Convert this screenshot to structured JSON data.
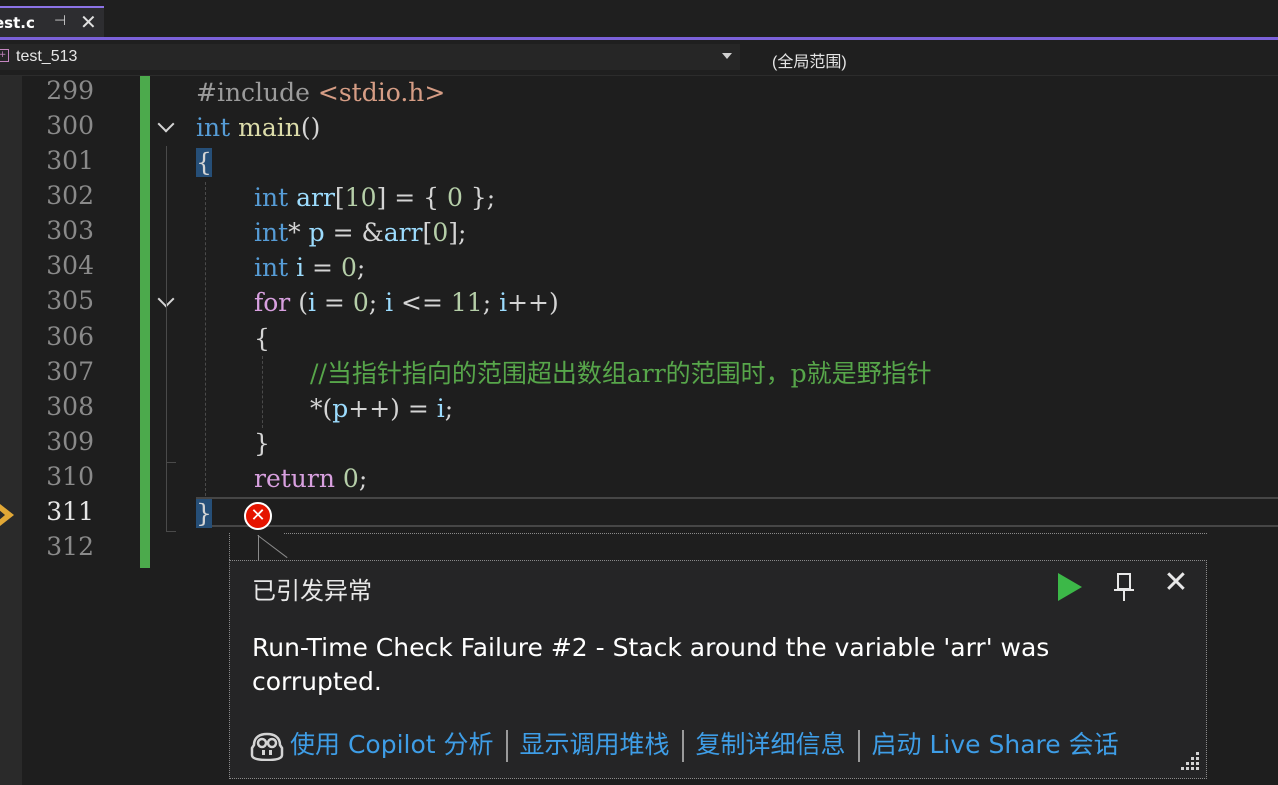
{
  "tab": {
    "title": "est.c",
    "pin": "⊣",
    "close": "✕"
  },
  "navbar": {
    "project": "test_513",
    "scope": "(全局范围)"
  },
  "editor": {
    "line_numbers": [
      "299",
      "300",
      "301",
      "302",
      "303",
      "304",
      "305",
      "306",
      "307",
      "308",
      "309",
      "310",
      "311",
      "312"
    ],
    "current_line": "311",
    "tokens": {
      "l299_pre": "#include ",
      "l299_str": "<stdio.h>",
      "l300_kw": "int",
      "l300_fn": "main",
      "l300_rest": "()",
      "l301": "{",
      "l302_kw": "int",
      "l302_var": "arr",
      "l302_a": "[",
      "l302_n": "10",
      "l302_b": "] = { ",
      "l302_z": "0",
      "l302_c": " };",
      "l303_kw": "int",
      "l303_a": "* ",
      "l303_p": "p",
      "l303_b": " = &",
      "l303_arr": "arr",
      "l303_c": "[",
      "l303_z": "0",
      "l303_d": "];",
      "l304_kw": "int",
      "l304_i": "i",
      "l304_a": " = ",
      "l304_z": "0",
      "l304_b": ";",
      "l305_for": "for",
      "l305_a": " (",
      "l305_i1": "i",
      "l305_b": " = ",
      "l305_z": "0",
      "l305_c": "; ",
      "l305_i2": "i",
      "l305_d": " <= ",
      "l305_n": "11",
      "l305_e": "; ",
      "l305_i3": "i",
      "l305_f": "++)",
      "l306": "{",
      "l307_cmt": "//当指针指向的范围超出数组arr的范围时，p就是野指针",
      "l308_a": "*(",
      "l308_p": "p",
      "l308_b": "++) = ",
      "l308_i": "i",
      "l308_c": ";",
      "l309": "}",
      "l310_ret": "return",
      "l310_a": " ",
      "l310_z": "0",
      "l310_b": ";",
      "l311": "}"
    }
  },
  "error_badge": "✕",
  "exception_popup": {
    "title": "已引发异常",
    "message": "Run-Time Check Failure #2 - Stack around the variable 'arr' was corrupted.",
    "links": [
      "使用 Copilot 分析",
      "显示调用堆栈",
      "复制详细信息",
      "启动 Live Share 会话"
    ],
    "close": "✕"
  },
  "colors": {
    "accent": "#7b61d9",
    "change_bar": "#4caa4c",
    "error": "#e51400",
    "play": "#3cb848",
    "link": "#3e9de6",
    "keyword": "#569cd6",
    "comment": "#57a64a"
  },
  "icons": [
    "pin-icon",
    "close-icon",
    "execution-arrow-icon",
    "error-icon",
    "continue-play-icon",
    "copilot-icon",
    "resize-grip-icon",
    "fold-chevron-icon",
    "dropdown-caret-icon"
  ]
}
